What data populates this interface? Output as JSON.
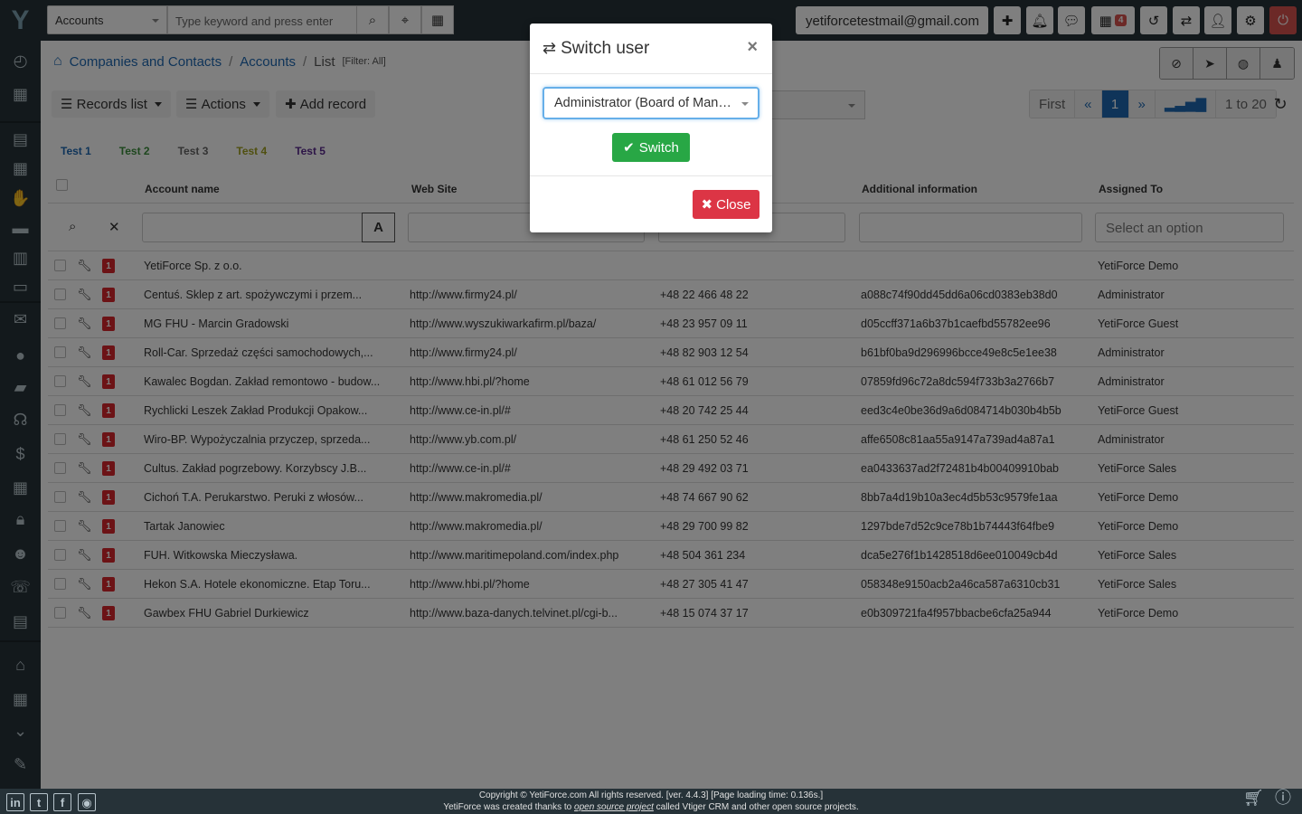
{
  "topbar": {
    "module_select": "Accounts",
    "search_placeholder": "Type keyword and press enter",
    "user_email": "yetiforcetestmail@gmail.com",
    "calendar_badge": "4"
  },
  "breadcrumb": {
    "items": [
      "Companies and Contacts",
      "Accounts",
      "List"
    ],
    "filter": "[Filter: All]"
  },
  "toolbar": {
    "records_list": "Records list",
    "actions": "Actions",
    "add_record": "Add record"
  },
  "pager": {
    "first": "First",
    "prev": "«",
    "page": "1",
    "next": "»",
    "range": "1 to 20"
  },
  "tabs": [
    {
      "label": "Test 1",
      "color": "#1f69b3"
    },
    {
      "label": "Test 2",
      "color": "#3c8f3c"
    },
    {
      "label": "Test 3",
      "color": "#666666"
    },
    {
      "label": "Test 4",
      "color": "#a0a020"
    },
    {
      "label": "Test 5",
      "color": "#5b2a8f"
    }
  ],
  "table": {
    "columns": [
      "Account name",
      "Web Site",
      "Additional information",
      "Assigned To"
    ],
    "assigned_placeholder": "Select an option",
    "filter_letter": "A",
    "rows": [
      {
        "name": "YetiForce Sp. z o.o.",
        "web": "",
        "phone": "",
        "info": "",
        "assigned": "YetiForce Demo"
      },
      {
        "name": "Centuś. Sklep z art. spożywczymi i przem...",
        "web": "http://www.firmy24.pl/",
        "phone": "+48 22 466 48 22",
        "info": "a088c74f90dd45dd6a06cd0383eb38d0",
        "assigned": "Administrator"
      },
      {
        "name": "MG FHU - Marcin Gradowski",
        "web": "http://www.wyszukiwarkafirm.pl/baza/",
        "phone": "+48 23 957 09 11",
        "info": "d05ccff371a6b37b1caefbd55782ee96",
        "assigned": "YetiForce Guest"
      },
      {
        "name": "Roll-Car. Sprzedaż części samochodowych,...",
        "web": "http://www.firmy24.pl/",
        "phone": "+48 82 903 12 54",
        "info": "b61bf0ba9d296996bcce49e8c5e1ee38",
        "assigned": "Administrator"
      },
      {
        "name": "Kawalec Bogdan. Zakład remontowo - budow...",
        "web": "http://www.hbi.pl/?home",
        "phone": "+48 61 012 56 79",
        "info": "07859fd96c72a8dc594f733b3a2766b7",
        "assigned": "Administrator"
      },
      {
        "name": "Rychlicki Leszek Zakład Produkcji Opakow...",
        "web": "http://www.ce-in.pl/#",
        "phone": "+48 20 742 25 44",
        "info": "eed3c4e0be36d9a6d084714b030b4b5b",
        "assigned": "YetiForce Guest"
      },
      {
        "name": "Wiro-BP. Wypożyczalnia przyczep, sprzeda...",
        "web": "http://www.yb.com.pl/",
        "phone": "+48 61 250 52 46",
        "info": "affe6508c81aa55a9147a739ad4a87a1",
        "assigned": "Administrator"
      },
      {
        "name": "Cultus. Zakład pogrzebowy. Korzybscy J.B...",
        "web": "http://www.ce-in.pl/#",
        "phone": "+48 29 492 03 71",
        "info": "ea0433637ad2f72481b4b00409910bab",
        "assigned": "YetiForce Sales"
      },
      {
        "name": "Cichoń T.A. Perukarstwo. Peruki z włosów...",
        "web": "http://www.makromedia.pl/",
        "phone": "+48 74 667 90 62",
        "info": "8bb7a4d19b10a3ec4d5b53c9579fe1aa",
        "assigned": "YetiForce Demo"
      },
      {
        "name": "Tartak Janowiec",
        "web": "http://www.makromedia.pl/",
        "phone": "+48 29 700 99 82",
        "info": "1297bde7d52c9ce78b1b74443f64fbe9",
        "assigned": "YetiForce Demo"
      },
      {
        "name": "FUH. Witkowska Mieczysława.",
        "web": "http://www.maritimepoland.com/index.php",
        "phone": "+48 504 361 234",
        "info": "dca5e276f1b1428518d6ee010049cb4d",
        "assigned": "YetiForce Sales"
      },
      {
        "name": "Hekon S.A. Hotele ekonomiczne. Etap Toru...",
        "web": "http://www.hbi.pl/?home",
        "phone": "+48 27 305 41 47",
        "info": "058348e9150acb2a46ca587a6310cb31",
        "assigned": "YetiForce Sales"
      },
      {
        "name": "Gawbex FHU Gabriel Durkiewicz",
        "web": "http://www.baza-danych.telvinet.pl/cgi-b...",
        "phone": "+48 15 074 37 17",
        "info": "e0b309721fa4f957bbacbe6cfa25a944",
        "assigned": "YetiForce Demo"
      }
    ],
    "row_badge": "1"
  },
  "modal": {
    "title": "Switch user",
    "selected_user": "Administrator (Board of Management)",
    "switch_label": "Switch",
    "close_label": "Close"
  },
  "footer": {
    "line1": "Copyright © YetiForce.com All rights reserved. [ver. 4.4.3] [Page loading time: 0.136s.]",
    "line2_pre": "YetiForce was created thanks to ",
    "line2_link": "open source project",
    "line2_post": " called Vtiger CRM and other open source projects."
  },
  "colors": {
    "sidebar": "#263238",
    "primary": "#1f69b3",
    "success": "#28a745",
    "danger": "#dc3545"
  }
}
